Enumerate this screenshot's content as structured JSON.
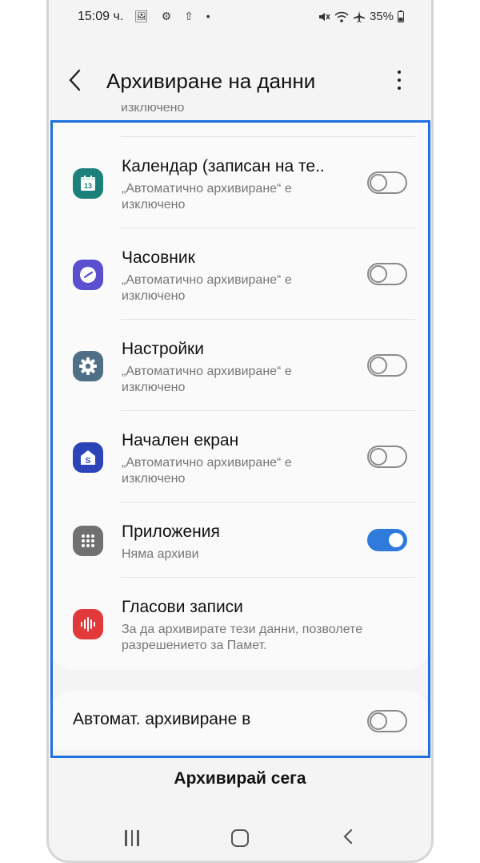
{
  "status_bar": {
    "time": "15:09 ч.",
    "left_icons": "🖼 ⚙ ⇧ •",
    "battery": "35%"
  },
  "header": {
    "title": "Архивиране на данни"
  },
  "cut_off_text": "изключено",
  "items": [
    {
      "title": "Календар (записан на те..",
      "subtitle": "„Автоматично архивиране“ е изключено",
      "icon": "calendar-icon",
      "icon_text": "13",
      "icon_color": "#1b7f7a",
      "toggle_on": false
    },
    {
      "title": "Часовник",
      "subtitle": "„Автоматично архивиране“ е изключено",
      "icon": "clock-icon",
      "icon_color": "#5a4fcf",
      "toggle_on": false
    },
    {
      "title": "Настройки",
      "subtitle": "„Автоматично архивиране“ е изключено",
      "icon": "gear-icon",
      "icon_color": "#4e6f86",
      "toggle_on": false
    },
    {
      "title": "Начален екран",
      "subtitle": "„Автоматично архивиране“ е изключено",
      "icon": "home-screen-icon",
      "icon_text": "S",
      "icon_color": "#2d44b8",
      "toggle_on": false
    },
    {
      "title": "Приложения",
      "subtitle": "Няма архиви",
      "icon": "apps-grid-icon",
      "icon_color": "#707070",
      "toggle_on": true
    },
    {
      "title": "Гласови записи",
      "subtitle": "За да архивирате тези данни, позволете разрешението за Памет.",
      "icon": "voice-recorder-icon",
      "icon_color": "#e23a3a"
    }
  ],
  "auto_backup": {
    "label": "Автомат. архивиране в",
    "toggle_on": false
  },
  "backup_now_label": "Архивирай сега",
  "colors": {
    "accent": "#2f7bdc",
    "highlight": "#1e6fe0"
  }
}
